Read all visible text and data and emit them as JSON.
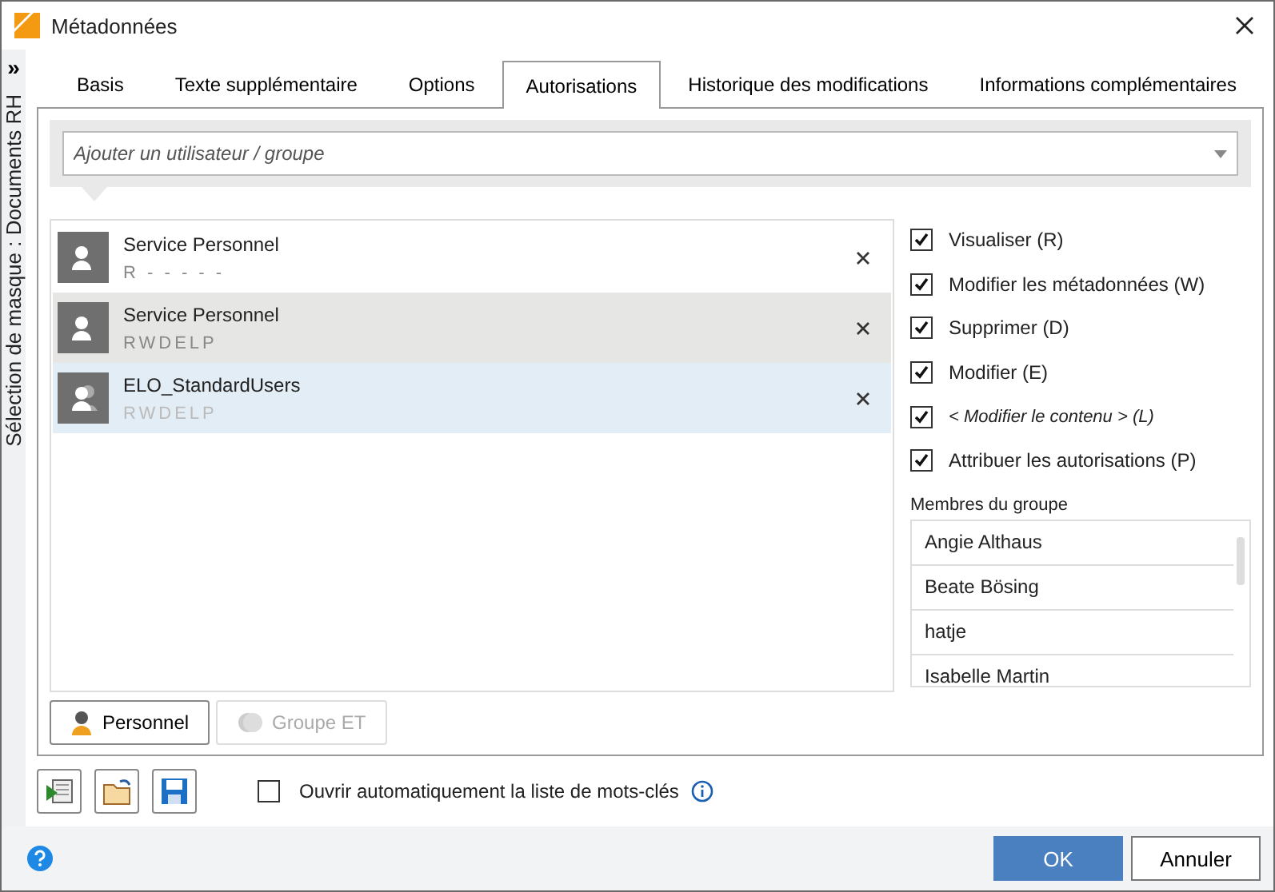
{
  "window": {
    "title": "Métadonnées"
  },
  "sidebar": {
    "toggle": "»",
    "label": "Sélection de masque : Documents RH"
  },
  "tabs": [
    {
      "label": "Basis",
      "selected": false
    },
    {
      "label": "Texte supplémentaire",
      "selected": false
    },
    {
      "label": "Options",
      "selected": false
    },
    {
      "label": "Autorisations",
      "selected": true
    },
    {
      "label": "Historique des modifications",
      "selected": false
    },
    {
      "label": "Informations complémentaires",
      "selected": false
    }
  ],
  "add_field": {
    "placeholder": "Ajouter un utilisateur / groupe"
  },
  "entries": [
    {
      "kind": "user",
      "name": "Service Personnel",
      "rights": "R - - - - -",
      "selected": false,
      "hovered": false
    },
    {
      "kind": "user",
      "name": "Service Personnel",
      "rights": "RWDELP",
      "selected": true,
      "hovered": false
    },
    {
      "kind": "group",
      "name": "ELO_StandardUsers",
      "rights": "RWDELP",
      "selected": false,
      "hovered": true
    }
  ],
  "permissions": [
    {
      "label": "Visualiser (R)",
      "checked": true,
      "italic": false
    },
    {
      "label": "Modifier les métadonnées (W)",
      "checked": true,
      "italic": false
    },
    {
      "label": "Supprimer (D)",
      "checked": true,
      "italic": false
    },
    {
      "label": "Modifier (E)",
      "checked": true,
      "italic": false
    },
    {
      "label": "< Modifier le contenu > (L)",
      "checked": true,
      "italic": true
    },
    {
      "label": "Attribuer les autorisations (P)",
      "checked": true,
      "italic": false
    }
  ],
  "members": {
    "title": "Membres du groupe",
    "items": [
      "Angie Althaus",
      "Beate Bösing",
      "hatje",
      "Isabelle Martin"
    ]
  },
  "filter_buttons": [
    {
      "label": "Personnel",
      "disabled": false
    },
    {
      "label": "Groupe ET",
      "disabled": true
    }
  ],
  "auto_open": {
    "label": "Ouvrir automatiquement la liste de mots-clés",
    "checked": false
  },
  "buttons": [
    {
      "label": "OK",
      "kind": "primary"
    },
    {
      "label": "Annuler",
      "kind": "secondary"
    }
  ]
}
